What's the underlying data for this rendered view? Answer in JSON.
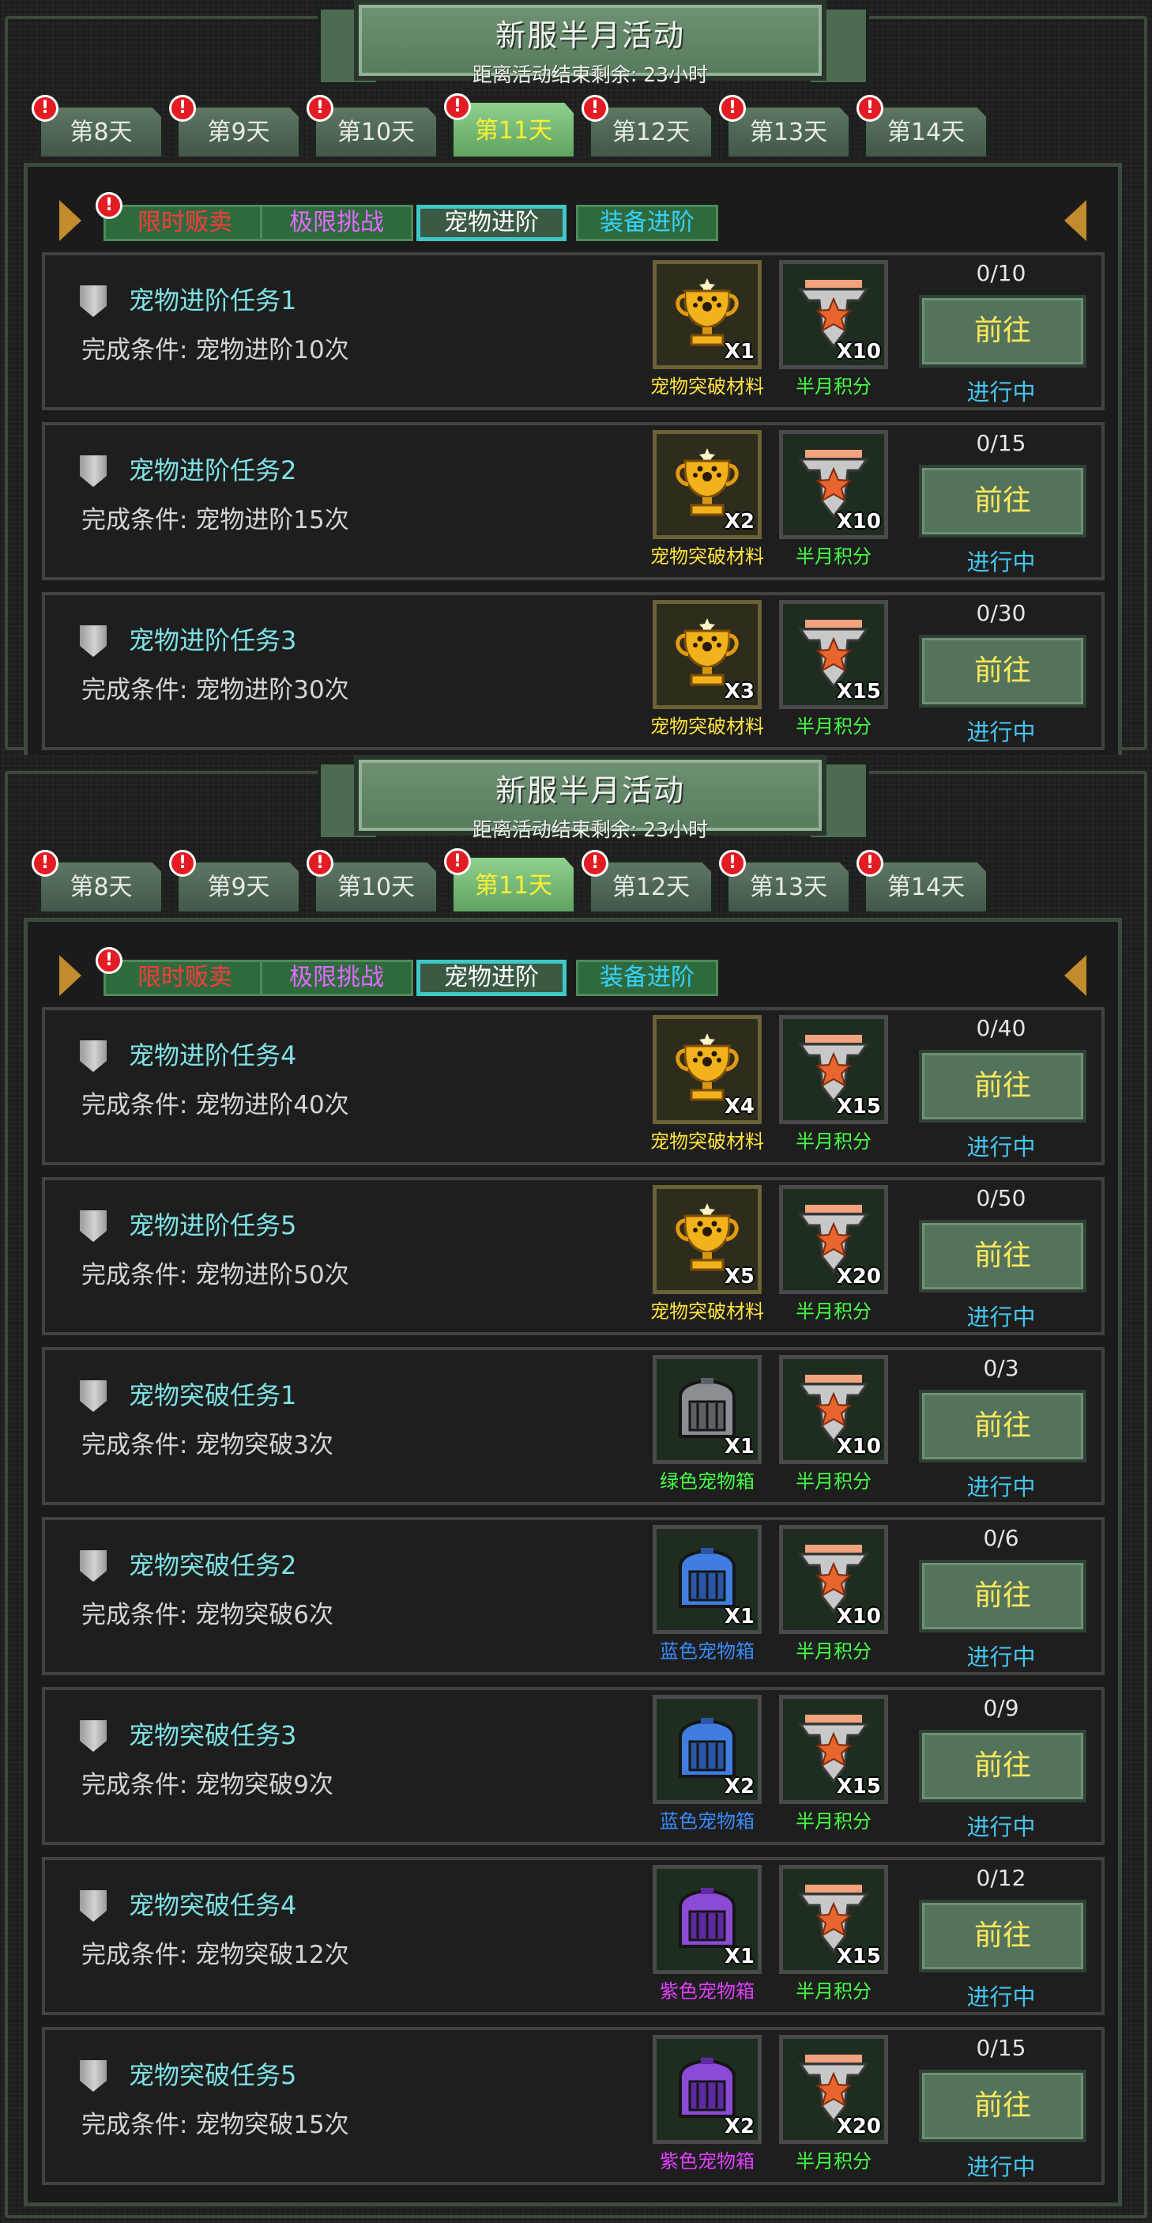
{
  "panels": [
    {
      "banner": {
        "title": "新服半月活动",
        "subtitle": "距离活动结束剩余: 23小时"
      },
      "day_tabs": [
        "第8天",
        "第9天",
        "第10天",
        "第11天",
        "第12天",
        "第13天",
        "第14天"
      ],
      "active_day_index": 3,
      "categories": [
        "限时贩卖",
        "极限挑战",
        "宠物进阶",
        "装备进阶"
      ],
      "active_category_index": 2,
      "tasks": [
        {
          "title": "宠物进阶任务1",
          "condition": "完成条件: 宠物进阶10次",
          "reward1": {
            "name": "宠物突破材料",
            "qty": "X1",
            "icon": "trophy-icon"
          },
          "reward2": {
            "name": "半月积分",
            "qty": "X10",
            "icon": "points-badge-icon"
          },
          "progress": "0/10",
          "button": "前往",
          "status": "进行中"
        },
        {
          "title": "宠物进阶任务2",
          "condition": "完成条件: 宠物进阶15次",
          "reward1": {
            "name": "宠物突破材料",
            "qty": "X2",
            "icon": "trophy-icon"
          },
          "reward2": {
            "name": "半月积分",
            "qty": "X10",
            "icon": "points-badge-icon"
          },
          "progress": "0/15",
          "button": "前往",
          "status": "进行中"
        },
        {
          "title": "宠物进阶任务3",
          "condition": "完成条件: 宠物进阶30次",
          "reward1": {
            "name": "宠物突破材料",
            "qty": "X3",
            "icon": "trophy-icon"
          },
          "reward2": {
            "name": "半月积分",
            "qty": "X15",
            "icon": "points-badge-icon"
          },
          "progress": "0/30",
          "button": "前往",
          "status": "进行中"
        }
      ]
    },
    {
      "banner": {
        "title": "新服半月活动",
        "subtitle": "距离活动结束剩余: 23小时"
      },
      "day_tabs": [
        "第8天",
        "第9天",
        "第10天",
        "第11天",
        "第12天",
        "第13天",
        "第14天"
      ],
      "active_day_index": 3,
      "categories": [
        "限时贩卖",
        "极限挑战",
        "宠物进阶",
        "装备进阶"
      ],
      "active_category_index": 2,
      "tasks": [
        {
          "title": "宠物进阶任务4",
          "condition": "完成条件: 宠物进阶40次",
          "reward1": {
            "name": "宠物突破材料",
            "qty": "X4",
            "icon": "trophy-icon"
          },
          "reward2": {
            "name": "半月积分",
            "qty": "X15",
            "icon": "points-badge-icon"
          },
          "progress": "0/40",
          "button": "前往",
          "status": "进行中"
        },
        {
          "title": "宠物进阶任务5",
          "condition": "完成条件: 宠物进阶50次",
          "reward1": {
            "name": "宠物突破材料",
            "qty": "X5",
            "icon": "trophy-icon"
          },
          "reward2": {
            "name": "半月积分",
            "qty": "X20",
            "icon": "points-badge-icon"
          },
          "progress": "0/50",
          "button": "前往",
          "status": "进行中"
        },
        {
          "title": "宠物突破任务1",
          "condition": "完成条件: 宠物突破3次",
          "reward1": {
            "name": "绿色宠物箱",
            "qty": "X1",
            "icon": "green-pet-crate-icon"
          },
          "reward2": {
            "name": "半月积分",
            "qty": "X10",
            "icon": "points-badge-icon"
          },
          "progress": "0/3",
          "button": "前往",
          "status": "进行中"
        },
        {
          "title": "宠物突破任务2",
          "condition": "完成条件: 宠物突破6次",
          "reward1": {
            "name": "蓝色宠物箱",
            "qty": "X1",
            "icon": "blue-pet-crate-icon"
          },
          "reward2": {
            "name": "半月积分",
            "qty": "X10",
            "icon": "points-badge-icon"
          },
          "progress": "0/6",
          "button": "前往",
          "status": "进行中"
        },
        {
          "title": "宠物突破任务3",
          "condition": "完成条件: 宠物突破9次",
          "reward1": {
            "name": "蓝色宠物箱",
            "qty": "X2",
            "icon": "blue-pet-crate-icon"
          },
          "reward2": {
            "name": "半月积分",
            "qty": "X15",
            "icon": "points-badge-icon"
          },
          "progress": "0/9",
          "button": "前往",
          "status": "进行中"
        },
        {
          "title": "宠物突破任务4",
          "condition": "完成条件: 宠物突破12次",
          "reward1": {
            "name": "紫色宠物箱",
            "qty": "X1",
            "icon": "purple-pet-crate-icon"
          },
          "reward2": {
            "name": "半月积分",
            "qty": "X15",
            "icon": "points-badge-icon"
          },
          "progress": "0/12",
          "button": "前往",
          "status": "进行中"
        },
        {
          "title": "宠物突破任务5",
          "condition": "完成条件: 宠物突破15次",
          "reward1": {
            "name": "紫色宠物箱",
            "qty": "X2",
            "icon": "purple-pet-crate-icon"
          },
          "reward2": {
            "name": "半月积分",
            "qty": "X20",
            "icon": "points-badge-icon"
          },
          "progress": "0/15",
          "button": "前往",
          "status": "进行中"
        }
      ]
    }
  ],
  "colors": {
    "category_text": [
      "#ff3b3b",
      "#e06bff",
      "#ffffff",
      "#35d2ff"
    ],
    "reward_name": {
      "trophy-icon": "#ffe23d",
      "points-badge-icon": "#46ff46",
      "green-pet-crate-icon": "#46ff46",
      "blue-pet-crate-icon": "#3a8cff",
      "purple-pet-crate-icon": "#e040ff"
    },
    "alert": "#e31c23",
    "task_title": "#7fe2e6",
    "status": "#47c5ee",
    "button_text": "#ffe95a"
  }
}
